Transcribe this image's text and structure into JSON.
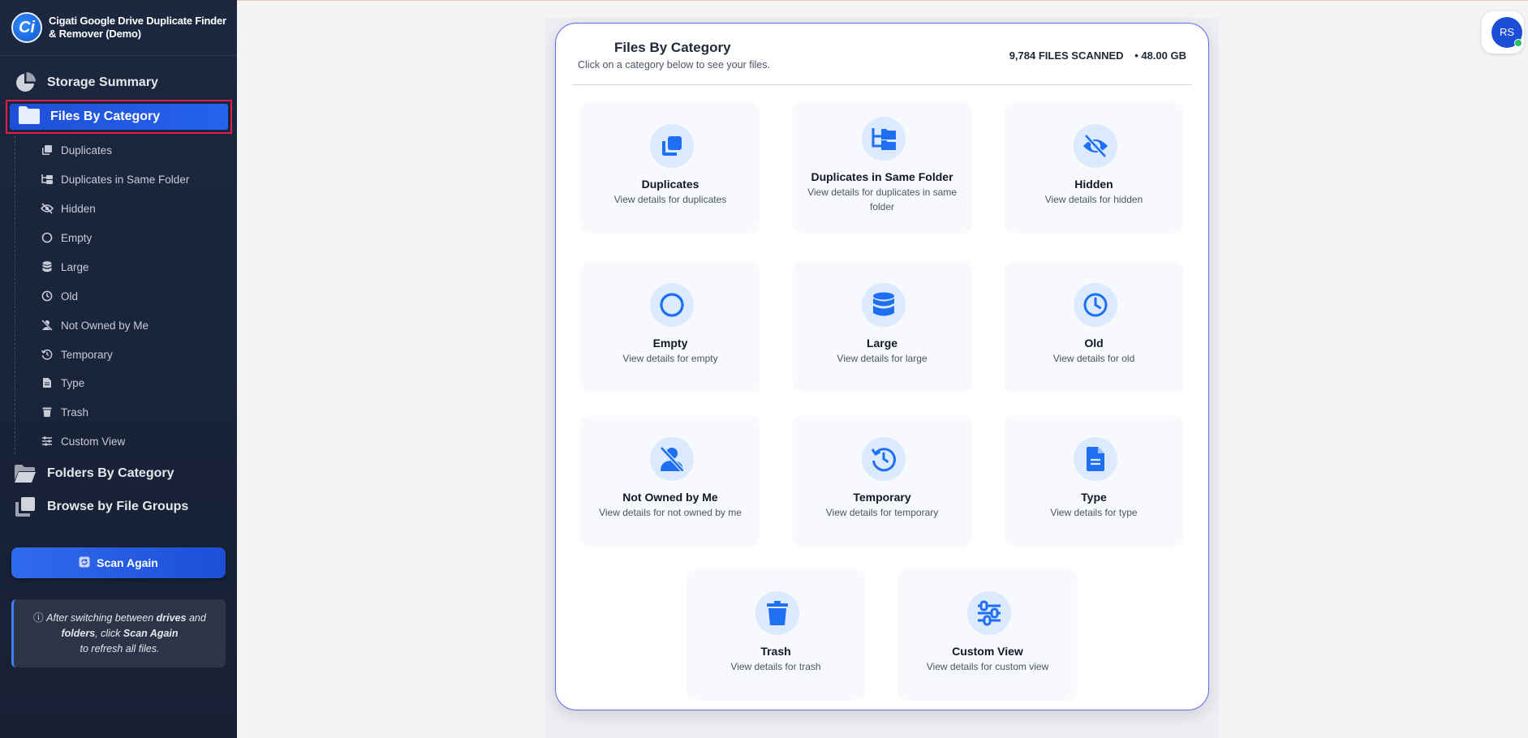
{
  "app": {
    "title": "Cigati Google Drive Duplicate Finder & Remover (Demo)",
    "logo_letter": "Ci"
  },
  "sidebar": {
    "storage_summary": "Storage Summary",
    "files_by_category": "Files By Category",
    "sub_items": [
      "Duplicates",
      "Duplicates in Same Folder",
      "Hidden",
      "Empty",
      "Large",
      "Old",
      "Not Owned by Me",
      "Temporary",
      "Type",
      "Trash",
      "Custom View"
    ],
    "folders_by_category": "Folders By Category",
    "browse_by_file_groups": "Browse by File Groups",
    "scan_again": "Scan Again",
    "note": {
      "p1": "After switching between ",
      "drives": "drives",
      "p2": " and ",
      "folders": "folders",
      "p3": ",  click ",
      "scan_again": "Scan Again",
      "p4": "to refresh all files."
    }
  },
  "main": {
    "title": "Files By Category",
    "subtitle": "Click on a category below to see your files.",
    "files_scanned": "9,784 FILES SCANNED",
    "size": "• 48.00 GB",
    "tiles": [
      {
        "name": "Duplicates",
        "desc": "View details for duplicates",
        "icon": "copy-icon"
      },
      {
        "name": "Duplicates in Same Folder",
        "desc": "View details for duplicates in same folder",
        "icon": "folder-tree-icon"
      },
      {
        "name": "Hidden",
        "desc": "View details for hidden",
        "icon": "eye-slash-icon"
      },
      {
        "name": "Empty",
        "desc": "View details for empty",
        "icon": "circle-icon"
      },
      {
        "name": "Large",
        "desc": "View details for large",
        "icon": "database-icon"
      },
      {
        "name": "Old",
        "desc": "View details for old",
        "icon": "clock-icon"
      },
      {
        "name": "Not Owned by Me",
        "desc": "View details for not owned by me",
        "icon": "user-slash-icon"
      },
      {
        "name": "Temporary",
        "desc": "View details for temporary",
        "icon": "history-icon"
      },
      {
        "name": "Type",
        "desc": "View details for type",
        "icon": "file-icon"
      },
      {
        "name": "Trash",
        "desc": "View details for trash",
        "icon": "trash-icon"
      },
      {
        "name": "Custom View",
        "desc": "View details for custom view",
        "icon": "sliders-icon"
      }
    ]
  },
  "user": {
    "initials": "RS"
  },
  "colors": {
    "accent": "#2563eb",
    "sidebar_bg": "#1c2740",
    "icon_blue": "#1e6ff2",
    "icon_bg": "#dbeafe"
  }
}
